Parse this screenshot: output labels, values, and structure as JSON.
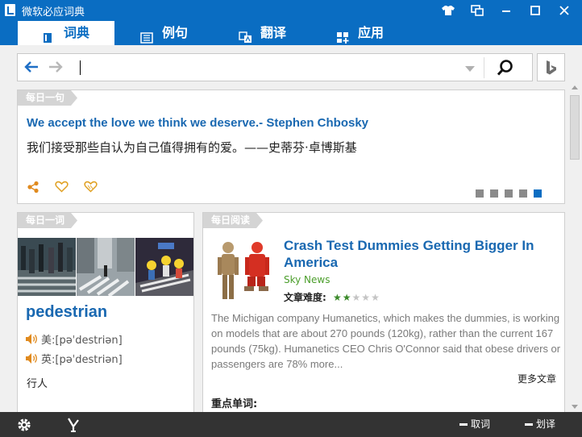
{
  "window": {
    "title": "微软必应词典",
    "buttons": [
      "shirt-icon",
      "mini-mode-icon",
      "minimize-icon",
      "maximize-icon",
      "close-icon"
    ]
  },
  "tabs": [
    {
      "label": "词典",
      "icon": "book-icon",
      "active": true
    },
    {
      "label": "例句",
      "icon": "list-icon",
      "active": false
    },
    {
      "label": "翻译",
      "icon": "translate-icon",
      "active": false
    },
    {
      "label": "应用",
      "icon": "apps-icon",
      "active": false
    }
  ],
  "search": {
    "value": "",
    "placeholder": ""
  },
  "daily_sentence": {
    "tag": "每日一句",
    "english": "We accept the love we think we deserve.- Stephen Chbosky",
    "chinese": "我们接受那些自认为自己值得拥有的爱。——史蒂芬·卓博斯基",
    "pager_count": 5,
    "pager_active": 5
  },
  "daily_word": {
    "tag": "每日一词",
    "word": "pedestrian",
    "us_label": "美:",
    "us_phonetic": "[pəˈdestriən]",
    "uk_label": "英:",
    "uk_phonetic": "[pəˈdestriən]",
    "definition": "行人"
  },
  "daily_reading": {
    "tag": "每日阅读",
    "title": "Crash Test Dummies Getting Bigger In America",
    "source": "Sky News",
    "difficulty_label": "文章难度:",
    "difficulty_rating": 2,
    "difficulty_max": 5,
    "body": "The Michigan company Humanetics, which makes the dummies, is working on models that are about 270 pounds (120kg), rather than the current 167 pounds (75kg). Humanetics CEO Chris O'Connor said that obese drivers or passengers are 78% more...",
    "more_link": "更多文章",
    "keywords_label": "重点单词:"
  },
  "bottom_bar": {
    "settings_icon": "gear-icon",
    "mini_icon": "pin-icon",
    "word_pick": "取词",
    "word_select": "划译"
  },
  "colors": {
    "accent": "#0a6dc2",
    "title_blue": "#1968b1",
    "source_green": "#4b9e2b",
    "bottom_bar": "#333333",
    "star_on": "#3b8a2a"
  }
}
